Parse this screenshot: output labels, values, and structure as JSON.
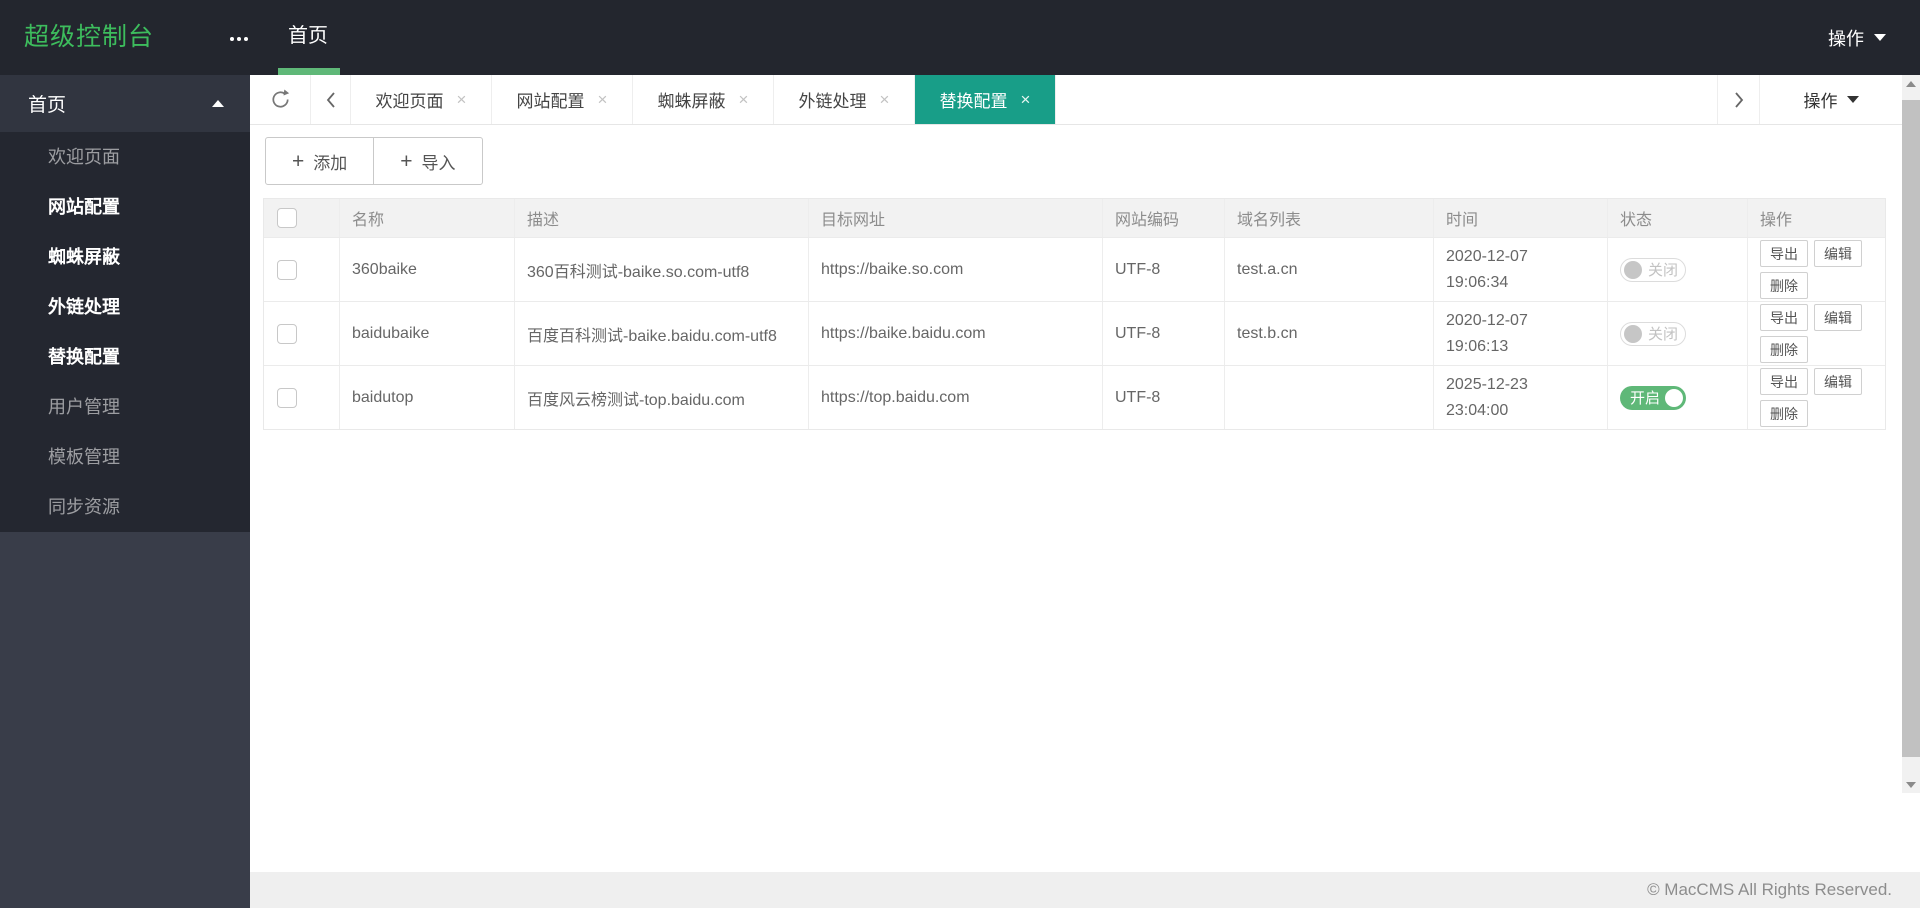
{
  "app": {
    "logo": "超级控制台",
    "home_label": "首页",
    "action_label": "操作"
  },
  "icons": {
    "close": "×",
    "plus": "+"
  },
  "colors": {
    "accent_green": "#5FB878",
    "active_tab_teal": "#189e88",
    "logo_green": "#3dbd5d",
    "header_bg": "#23262e",
    "sidebar_bg": "#393d49"
  },
  "sidebar": {
    "parent_label": "首页",
    "items": [
      {
        "label": "欢迎页面",
        "active": false
      },
      {
        "label": "网站配置",
        "active": true
      },
      {
        "label": "蜘蛛屏蔽",
        "active": true
      },
      {
        "label": "外链处理",
        "active": true
      },
      {
        "label": "替换配置",
        "active": true
      },
      {
        "label": "用户管理",
        "active": false
      },
      {
        "label": "模板管理",
        "active": false
      },
      {
        "label": "同步资源",
        "active": false
      }
    ]
  },
  "tabbar": {
    "tabs": [
      {
        "label": "欢迎页面",
        "active": false
      },
      {
        "label": "网站配置",
        "active": false
      },
      {
        "label": "蜘蛛屏蔽",
        "active": false
      },
      {
        "label": "外链处理",
        "active": false
      },
      {
        "label": "替换配置",
        "active": true
      }
    ],
    "action_label": "操作"
  },
  "toolbar": {
    "add_label": "添加",
    "import_label": "导入"
  },
  "table": {
    "headers": [
      "名称",
      "描述",
      "目标网址",
      "网站编码",
      "域名列表",
      "时间",
      "状态",
      "操作"
    ],
    "action_buttons": [
      "导出",
      "编辑",
      "删除"
    ],
    "rows": [
      {
        "name": "360baike",
        "desc": "360百科测试-baike.so.com-utf8",
        "url": "https://baike.so.com",
        "encoding": "UTF-8",
        "domains": "test.a.cn",
        "date": "2020-12-07",
        "time": "19:06:34",
        "status": "off",
        "status_label": "关闭"
      },
      {
        "name": "baidubaike",
        "desc": "百度百科测试-baike.baidu.com-utf8",
        "url": "https://baike.baidu.com",
        "encoding": "UTF-8",
        "domains": "test.b.cn",
        "date": "2020-12-07",
        "time": "19:06:13",
        "status": "off",
        "status_label": "关闭"
      },
      {
        "name": "baidutop",
        "desc": "百度风云榜测试-top.baidu.com",
        "url": "https://top.baidu.com",
        "encoding": "UTF-8",
        "domains": "",
        "date": "2025-12-23",
        "time": "23:04:00",
        "status": "on",
        "status_label": "开启"
      }
    ]
  },
  "footer": {
    "copyright": "© MacCMS All Rights Reserved."
  }
}
